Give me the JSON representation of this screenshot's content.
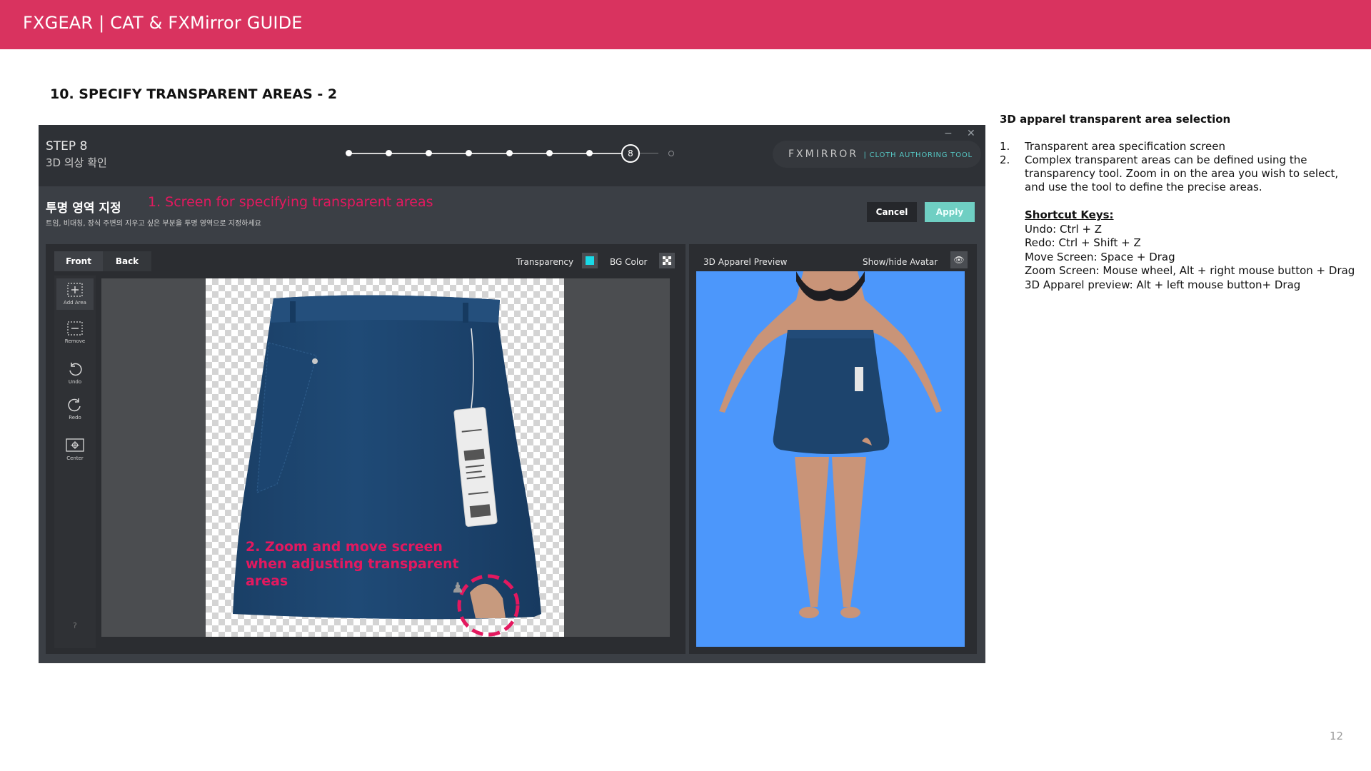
{
  "banner": {
    "title": "FXGEAR | CAT & FXMirror GUIDE"
  },
  "section": {
    "title": "10. SPECIFY TRANSPARENT AREAS - 2"
  },
  "app": {
    "window_minimize": "−",
    "window_close": "✕",
    "step_title": "STEP 8",
    "step_subtitle": "3D 의상 확인",
    "progress": {
      "current_step": "8",
      "total_steps": 9
    },
    "brand": {
      "name": "FXMIRROR",
      "sub": "| CLOTH AUTHORING TOOL"
    },
    "area_title": "투명 영역 지정",
    "area_desc": "트임, 비대칭, 장식 주변의 지우고 싶은 부분을 투명 영역으로 지정하세요",
    "buttons": {
      "cancel": "Cancel",
      "apply": "Apply"
    },
    "editor": {
      "tabs": [
        "Front",
        "Back"
      ],
      "transparency_label": "Transparency",
      "bg_color_label": "BG Color",
      "tools": [
        {
          "label": "Add Area",
          "icon": "add-area-icon"
        },
        {
          "label": "Remove",
          "icon": "remove-area-icon"
        },
        {
          "label": "Undo",
          "icon": "undo-icon"
        },
        {
          "label": "Redo",
          "icon": "redo-icon"
        },
        {
          "label": "Center",
          "icon": "center-icon"
        }
      ],
      "help": "?"
    },
    "preview": {
      "title": "3D Apparel Preview",
      "toggle_label": "Show/hide Avatar",
      "eye_icon": "eye-icon"
    }
  },
  "annotations": {
    "screen_label": "1. Screen for specifying transparent areas",
    "zoom_label": "2. Zoom and move screen when adjusting transparent areas"
  },
  "colors": {
    "banner": "#d9335f",
    "annotation": "#e4185f",
    "apply_button": "#6fcfc3",
    "preview_bg": "#4c97fb",
    "skirt": "#1d446d"
  },
  "description": {
    "heading": "3D apparel transparent area selection",
    "steps": [
      {
        "num": "1.",
        "text": "Transparent area specification screen"
      },
      {
        "num": "2.",
        "text": "Complex transparent areas can be defined using the transparency tool. Zoom in on the area you wish to select, and use the tool to define the precise areas."
      }
    ],
    "shortcuts_title": "Shortcut Keys:",
    "shortcuts": [
      "Undo: Ctrl + Z",
      "Redo: Ctrl + Shift + Z",
      "Move Screen: Space + Drag",
      "Zoom Screen: Mouse wheel, Alt + right mouse button + Drag",
      "3D Apparel preview: Alt + left mouse button+ Drag"
    ]
  },
  "page_number": "12"
}
